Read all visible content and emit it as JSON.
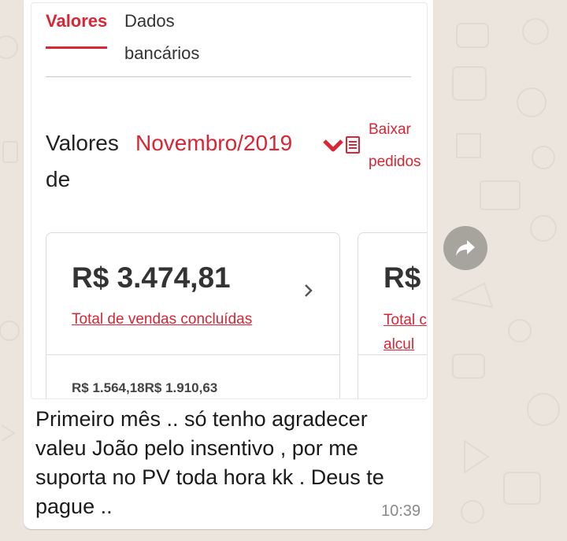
{
  "tabs": [
    {
      "label": "Valores",
      "active": true
    },
    {
      "label": "Dados bancários",
      "active": false
    }
  ],
  "heading": {
    "word": "Valores",
    "month": "Novembro/2019",
    "suffix": "de"
  },
  "download_link": "Baixar pedidos",
  "card_1": {
    "amount": "R$ 3.474,81",
    "link": "Total de vendas concluídas",
    "sub_values": "R$ 1.564,18R$ 1.910,63"
  },
  "card_2": {
    "amount": "R$",
    "link": "Total calcul"
  },
  "message": {
    "text": "Primeiro mês .. só tenho agradecer valeu João pelo insentivo , por me suporta no PV toda hora kk . Deus te pague ..",
    "time": "10:39"
  },
  "colors": {
    "accent": "#d92534",
    "chat_background": "#ece5dd",
    "bubble": "#ffffff",
    "forward_button": "#a7a49e"
  },
  "icons": [
    "chevron-down-icon",
    "document-icon",
    "chevron-right-icon",
    "forward-icon"
  ]
}
